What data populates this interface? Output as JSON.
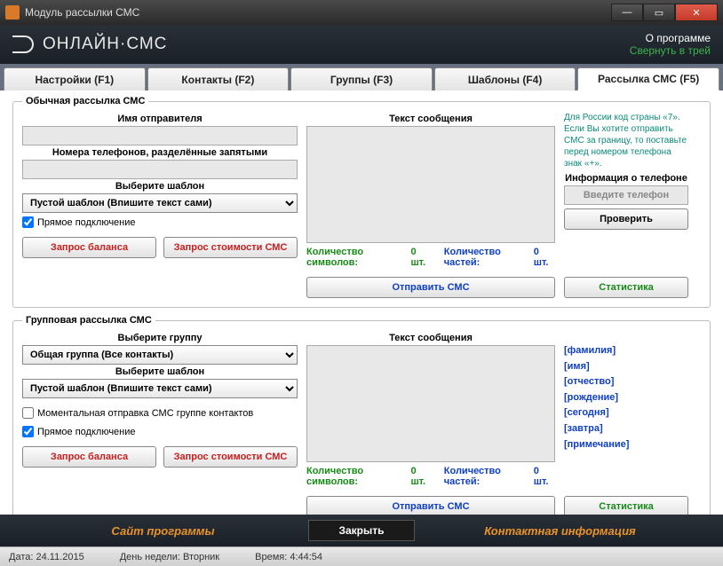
{
  "window": {
    "title": "Модуль рассылки СМС"
  },
  "header": {
    "logo": "ОНЛАЙН·СМС",
    "about": "О программе",
    "tray": "Свернуть в трей"
  },
  "tabs": [
    {
      "label": "Настройки (F1)"
    },
    {
      "label": "Контакты (F2)"
    },
    {
      "label": "Группы (F3)"
    },
    {
      "label": "Шаблоны (F4)"
    },
    {
      "label": "Рассылка СМС (F5)"
    }
  ],
  "section1": {
    "legend": "Обычная рассылка СМС",
    "sender_label": "Имя отправителя",
    "phones_label": "Номера телефонов, разделённые запятыми",
    "template_label": "Выберите шаблон",
    "template_value": "Пустой шаблон (Впишите текст сами)",
    "direct_conn": "Прямое подключение",
    "message_label": "Текст сообщения",
    "info_text": "Для России код страны «7». Если Вы хотите отправить СМС за границу, то поставьте перед номером телефона знак «+».",
    "info_phone": "Информация о телефоне",
    "phone_placeholder": "Введите телефон",
    "check_btn": "Проверить",
    "chars_label": "Количество символов: ",
    "chars_value": "0 шт.",
    "parts_label": "Количество частей: ",
    "parts_value": "0 шт.",
    "balance_btn": "Запрос баланса",
    "cost_btn": "Запрос стоимости СМС",
    "send_btn": "Отправить СМС",
    "stats_btn": "Статистика"
  },
  "section2": {
    "legend": "Групповая рассылка СМС",
    "group_label": "Выберите группу",
    "group_value": "Общая группа (Все контакты)",
    "template_label": "Выберите шаблон",
    "template_value": "Пустой шаблон (Впишите текст сами)",
    "instant_send": "Моментальная отправка СМС группе контактов",
    "direct_conn": "Прямое подключение",
    "message_label": "Текст сообщения",
    "chars_label": "Количество символов: ",
    "chars_value": "0 шт.",
    "parts_label": "Количество частей: ",
    "parts_value": "0 шт.",
    "balance_btn": "Запрос баланса",
    "cost_btn": "Запрос стоимости СМС",
    "send_btn": "Отправить СМС",
    "stats_btn": "Статистика",
    "placeholders": [
      "[фамилия]",
      "[имя]",
      "[отчество]",
      "[рождение]",
      "[сегодня]",
      "[завтра]",
      "[примечание]"
    ]
  },
  "footer": {
    "site": "Сайт программы",
    "close": "Закрыть",
    "contact": "Контактная информация"
  },
  "statusbar": {
    "date_label": "Дата: ",
    "date": "24.11.2015",
    "dow_label": "День недели: ",
    "dow": "Вторник",
    "time_label": "Время: ",
    "time": "4:44:54"
  }
}
